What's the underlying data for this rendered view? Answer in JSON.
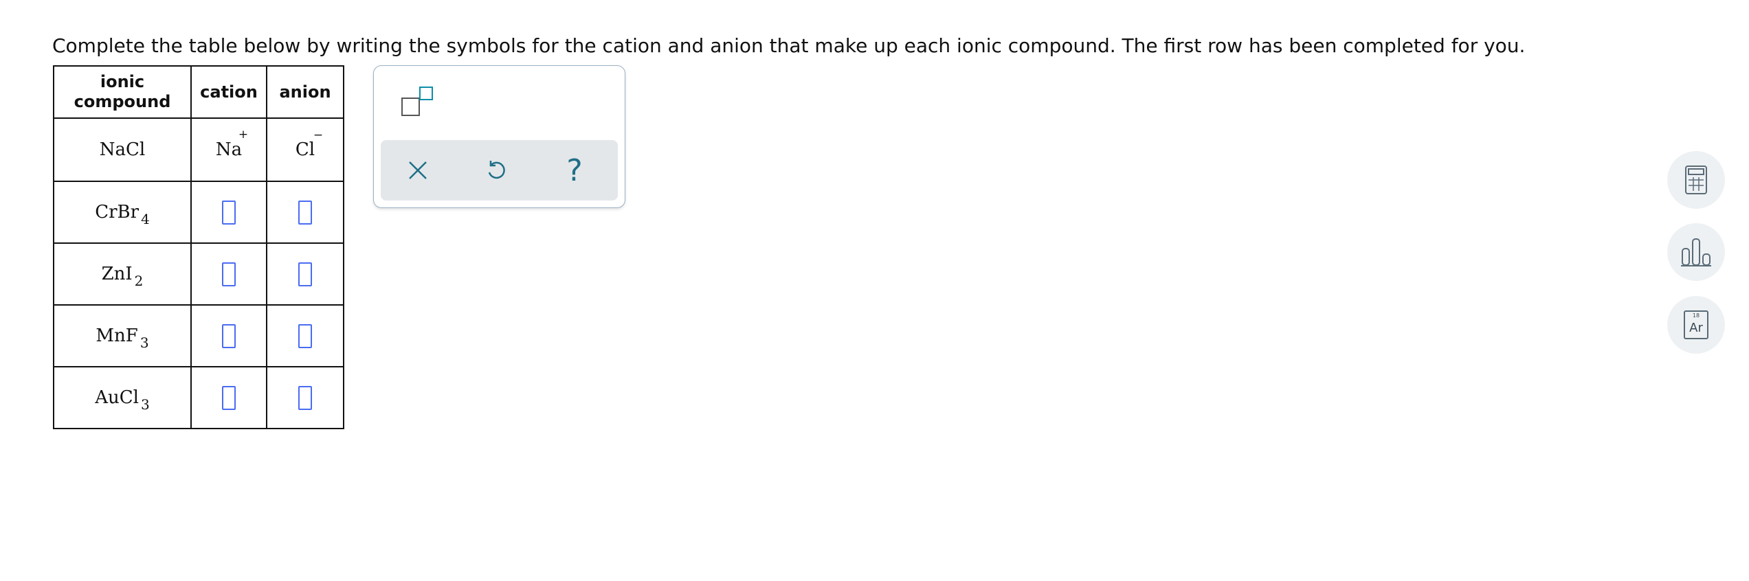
{
  "instruction": "Complete the table below by writing the symbols for the cation and anion that make up each ionic compound. The first row has been completed for you.",
  "table": {
    "headers": {
      "compound_line1": "ionic",
      "compound_line2": "compound",
      "cation": "cation",
      "anion": "anion"
    },
    "rows": [
      {
        "formula_main": "NaCl",
        "formula_sub": "",
        "cation_symbol": "Na",
        "cation_charge": "+",
        "anion_symbol": "Cl",
        "anion_charge": "−"
      },
      {
        "formula_main": "CrBr",
        "formula_sub": "4"
      },
      {
        "formula_main": "ZnI",
        "formula_sub": "2"
      },
      {
        "formula_main": "MnF",
        "formula_sub": "3"
      },
      {
        "formula_main": "AuCl",
        "formula_sub": "3"
      }
    ]
  },
  "palette": {
    "tools": [
      "superscript-box-icon"
    ],
    "buttons": [
      "clear-icon",
      "undo-icon",
      "help-icon"
    ],
    "help_label": "?"
  },
  "side_tools": {
    "periodic_number": "18",
    "periodic_symbol": "Ar"
  },
  "colors": {
    "answer_box": "#4a6cf2",
    "palette_icon": "#1f6f86",
    "superscript_small_box": "#0d8ea8"
  }
}
